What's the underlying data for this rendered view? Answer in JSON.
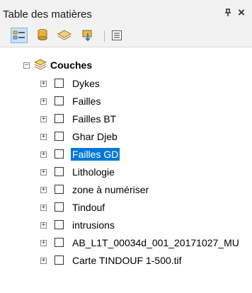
{
  "window": {
    "title": "Table des matières",
    "pin_glyph": "ᵖ",
    "close_glyph": "×"
  },
  "toolbar": {
    "buttons": [
      {
        "name": "list-by-drawing-order",
        "icon": "list-drawing-order-icon",
        "active": true
      },
      {
        "name": "list-by-source",
        "icon": "database-icon",
        "active": false
      },
      {
        "name": "list-by-visibility",
        "icon": "layers-icon",
        "active": false
      },
      {
        "name": "list-by-selection",
        "icon": "selection-icon",
        "active": false
      },
      {
        "name": "options",
        "icon": "options-list-icon",
        "active": false
      }
    ]
  },
  "tree": {
    "root": {
      "label": "Couches",
      "expanded": true,
      "icon": "layers-folder-icon"
    },
    "layers": [
      {
        "label": "Dykes",
        "checked": false,
        "selected": false
      },
      {
        "label": "Failles",
        "checked": false,
        "selected": false
      },
      {
        "label": "Failles BT",
        "checked": false,
        "selected": false
      },
      {
        "label": "Ghar Djeb",
        "checked": false,
        "selected": false
      },
      {
        "label": "Failles GD",
        "checked": false,
        "selected": true
      },
      {
        "label": "Lithologie",
        "checked": false,
        "selected": false
      },
      {
        "label": "zone à numériser",
        "checked": false,
        "selected": false
      },
      {
        "label": "Tindouf",
        "checked": false,
        "selected": false
      },
      {
        "label": "intrusions",
        "checked": false,
        "selected": false
      },
      {
        "label": "AB_L1T_00034d_001_20171027_MU",
        "checked": false,
        "selected": false
      },
      {
        "label": "Carte TINDOUF 1-500.tif",
        "checked": false,
        "selected": false
      }
    ]
  },
  "colors": {
    "selection": "#0078d7",
    "toolbar_bg": "#f2f2f2"
  }
}
